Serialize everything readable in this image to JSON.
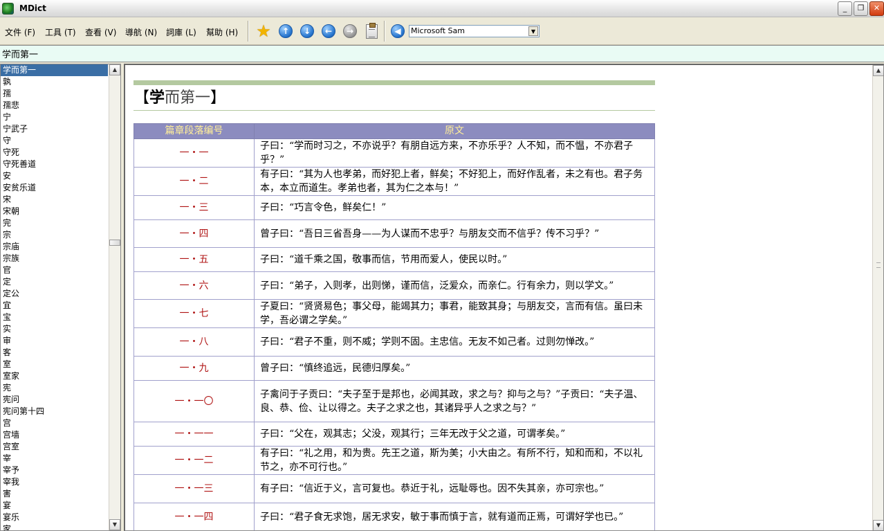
{
  "window": {
    "title": "MDict",
    "controls": {
      "minimize": "_",
      "restore": "❐",
      "close": "✕"
    }
  },
  "menu": [
    "文件 (F)",
    "工具 (T)",
    "查看 (V)",
    "導航 (N)",
    "詞庫 (L)",
    "幫助 (H)"
  ],
  "toolbar": {
    "icons": [
      "favorite-star-icon",
      "arrow-up-icon",
      "arrow-down-icon",
      "arrow-back-icon",
      "arrow-forward-icon",
      "clipboard-icon",
      "speaker-icon"
    ],
    "voice": "Microsoft Sam",
    "colors": {
      "icon_blue": "#2a78d0",
      "star": "#f2b400"
    }
  },
  "search": {
    "value": "学而第一"
  },
  "word_list": [
    "学而第一",
    "孰",
    "孺",
    "孺悲",
    "宁",
    "宁武子",
    "守",
    "守死",
    "守死善道",
    "安",
    "安贫乐道",
    "宋",
    "宋朝",
    "完",
    "宗",
    "宗庙",
    "宗族",
    "官",
    "定",
    "定公",
    "宜",
    "宝",
    "实",
    "审",
    "客",
    "室",
    "室家",
    "宪",
    "宪问",
    "宪问第十四",
    "宫",
    "宫墙",
    "宫室",
    "宰",
    "宰予",
    "宰我",
    "害",
    "宴",
    "宴乐",
    "家"
  ],
  "entry": {
    "heading_bracket_open": "【",
    "heading_bold": "学",
    "heading_rest": "而第一",
    "heading_bracket_close": "】",
    "colors": {
      "rule": "#b4c9a0",
      "header_bg": "#8c8cbf",
      "header_text": "#ffee99",
      "number_text": "#b01515"
    },
    "table": {
      "headers": [
        "篇章段落编号",
        "原文"
      ],
      "rows": [
        {
          "num": "一・一",
          "text": "子曰：“学而时习之，不亦说乎？有朋自远方来，不亦乐乎？人不知，而不愠，不亦君子乎？”"
        },
        {
          "num": "一・二",
          "text": "有子曰：“其为人也孝弟，而好犯上者，鲜矣；不好犯上，而好作乱者，未之有也。君子务本，本立而道生。孝弟也者，其为仁之本与！”"
        },
        {
          "num": "一・三",
          "text": "子曰：“巧言令色，鲜矣仁！”"
        },
        {
          "num": "一・四",
          "text": "曾子曰：“吾日三省吾身——为人谋而不忠乎？与朋友交而不信乎？传不习乎？”"
        },
        {
          "num": "一・五",
          "text": "子曰：“道千乘之国，敬事而信，节用而爱人，使民以时。”"
        },
        {
          "num": "一・六",
          "text": "子曰：“弟子，入则孝，出则悌，谨而信，泛爱众，而亲仁。行有余力，则以学文。”"
        },
        {
          "num": "一・七",
          "text": "子夏曰：“贤贤易色；事父母，能竭其力；事君，能致其身；与朋友交，言而有信。虽曰未学，吾必谓之学矣。”"
        },
        {
          "num": "一・八",
          "text": "子曰：“君子不重，则不威；学则不固。主忠信。无友不如己者。过则勿惮改。”"
        },
        {
          "num": "一・九",
          "text": "曾子曰：“慎终追远，民德归厚矣。”"
        },
        {
          "num": "一・一〇",
          "text": "子禽问于子贡曰：“夫子至于是邦也，必闻其政，求之与？抑与之与？”子贡曰：“夫子温、良、恭、俭、让以得之。夫子之求之也，其诸异乎人之求之与？”"
        },
        {
          "num": "一・一一",
          "text": "子曰：“父在，观其志；父没，观其行；三年无改于父之道，可谓孝矣。”"
        },
        {
          "num": "一・一二",
          "text": "有子曰：“礼之用，和为贵。先王之道，斯为美；小大由之。有所不行，知和而和，不以礼节之，亦不可行也。”"
        },
        {
          "num": "一・一三",
          "text": "有子曰：“信近于义，言可复也。恭近于礼，远耻辱也。因不失其亲，亦可宗也。”"
        },
        {
          "num": "一・一四",
          "text": "子曰：“君子食无求饱，居无求安，敏于事而慎于言，就有道而正焉，可谓好学也已。”"
        }
      ]
    }
  }
}
